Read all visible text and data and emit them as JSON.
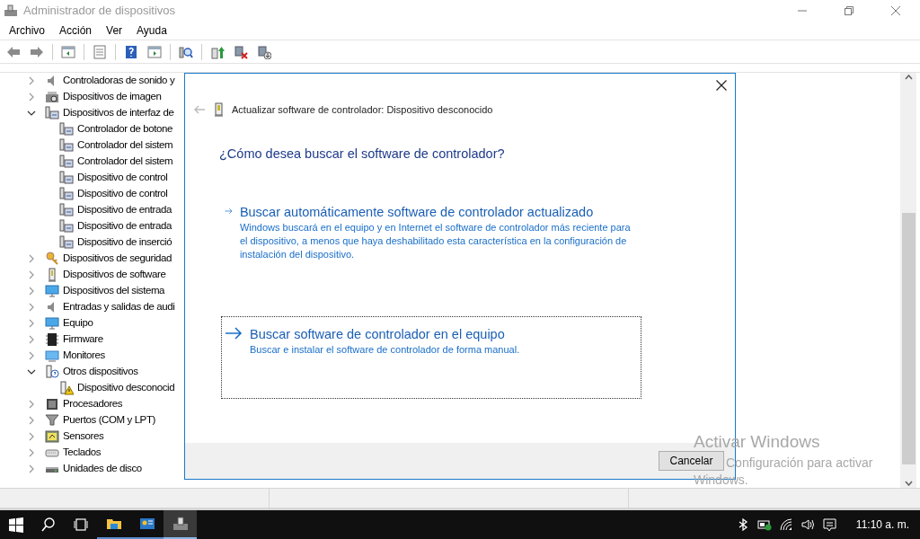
{
  "window": {
    "title": "Administrador de dispositivos"
  },
  "menu": [
    "Archivo",
    "Acción",
    "Ver",
    "Ayuda"
  ],
  "toolbar": [
    {
      "kind": "back"
    },
    {
      "kind": "forward"
    },
    {
      "kind": "sep"
    },
    {
      "kind": "pane"
    },
    {
      "kind": "sep"
    },
    {
      "kind": "properties"
    },
    {
      "kind": "sep"
    },
    {
      "kind": "help"
    },
    {
      "kind": "pane2"
    },
    {
      "kind": "sep"
    },
    {
      "kind": "scan"
    },
    {
      "kind": "sep"
    },
    {
      "kind": "update"
    },
    {
      "kind": "disable"
    },
    {
      "kind": "uninstall"
    }
  ],
  "tree": [
    {
      "label": "Controladoras de sonido y",
      "kind": "speaker",
      "expanded": false
    },
    {
      "label": "Dispositivos de imagen",
      "kind": "camera",
      "expanded": false
    },
    {
      "label": "Dispositivos de interfaz de",
      "kind": "hid",
      "expanded": true,
      "children": [
        {
          "label": "Controlador de botone",
          "kind": "hid"
        },
        {
          "label": "Controlador del sistem",
          "kind": "hid"
        },
        {
          "label": "Controlador del sistem",
          "kind": "hid"
        },
        {
          "label": "Dispositivo de control",
          "kind": "hid"
        },
        {
          "label": "Dispositivo de control",
          "kind": "hid"
        },
        {
          "label": "Dispositivo de entrada",
          "kind": "hid"
        },
        {
          "label": "Dispositivo de entrada",
          "kind": "hid"
        },
        {
          "label": "Dispositivo de inserció",
          "kind": "hid"
        }
      ]
    },
    {
      "label": "Dispositivos de seguridad",
      "kind": "key",
      "expanded": false
    },
    {
      "label": "Dispositivos de software",
      "kind": "device",
      "expanded": false
    },
    {
      "label": "Dispositivos del sistema",
      "kind": "monitor",
      "expanded": false
    },
    {
      "label": "Entradas y salidas de audi",
      "kind": "speaker",
      "expanded": false
    },
    {
      "label": "Equipo",
      "kind": "monitor",
      "expanded": false
    },
    {
      "label": "Firmware",
      "kind": "chip",
      "expanded": false
    },
    {
      "label": "Monitores",
      "kind": "screen",
      "expanded": false
    },
    {
      "label": "Otros dispositivos",
      "kind": "unknown",
      "expanded": true,
      "children": [
        {
          "label": "Dispositivo desconocid",
          "kind": "warning"
        }
      ]
    },
    {
      "label": "Procesadores",
      "kind": "cpu",
      "expanded": false
    },
    {
      "label": "Puertos (COM y LPT)",
      "kind": "port",
      "expanded": false
    },
    {
      "label": "Sensores",
      "kind": "sensor",
      "expanded": false
    },
    {
      "label": "Teclados",
      "kind": "keyboard",
      "expanded": false
    },
    {
      "label": "Unidades de disco",
      "kind": "disk",
      "expanded": false
    }
  ],
  "dialog": {
    "title": "Actualizar software de controlador: Dispositivo desconocido",
    "back_disabled": true,
    "heading": "¿Cómo desea buscar el software de controlador?",
    "options": [
      {
        "title": "Buscar automáticamente software de controlador actualizado",
        "description": "Windows buscará en el equipo y en Internet el software de controlador más reciente para el dispositivo, a menos que haya deshabilitado esta característica en la configuración de instalación del dispositivo.",
        "focused": false
      },
      {
        "title": "Buscar software de controlador en el equipo",
        "description": "Buscar e instalar el software de controlador de forma manual.",
        "focused": true
      }
    ],
    "cancel": "Cancelar"
  },
  "activation_notice": {
    "title": "Activar Windows",
    "lines": [
      "Configuración para activar",
      "Windows."
    ]
  },
  "taskbar": {
    "apps": [
      {
        "kind": "start",
        "active": false
      },
      {
        "kind": "search",
        "active": false
      },
      {
        "kind": "taskview",
        "active": false
      },
      {
        "kind": "folder",
        "active": false
      },
      {
        "kind": "app",
        "active": false
      },
      {
        "kind": "devmgr",
        "active": true
      }
    ],
    "tray": [
      {
        "kind": "bluetooth"
      },
      {
        "kind": "power"
      },
      {
        "kind": "network"
      },
      {
        "kind": "volume"
      },
      {
        "kind": "notifications"
      }
    ],
    "clock": "11:10 a. m."
  }
}
